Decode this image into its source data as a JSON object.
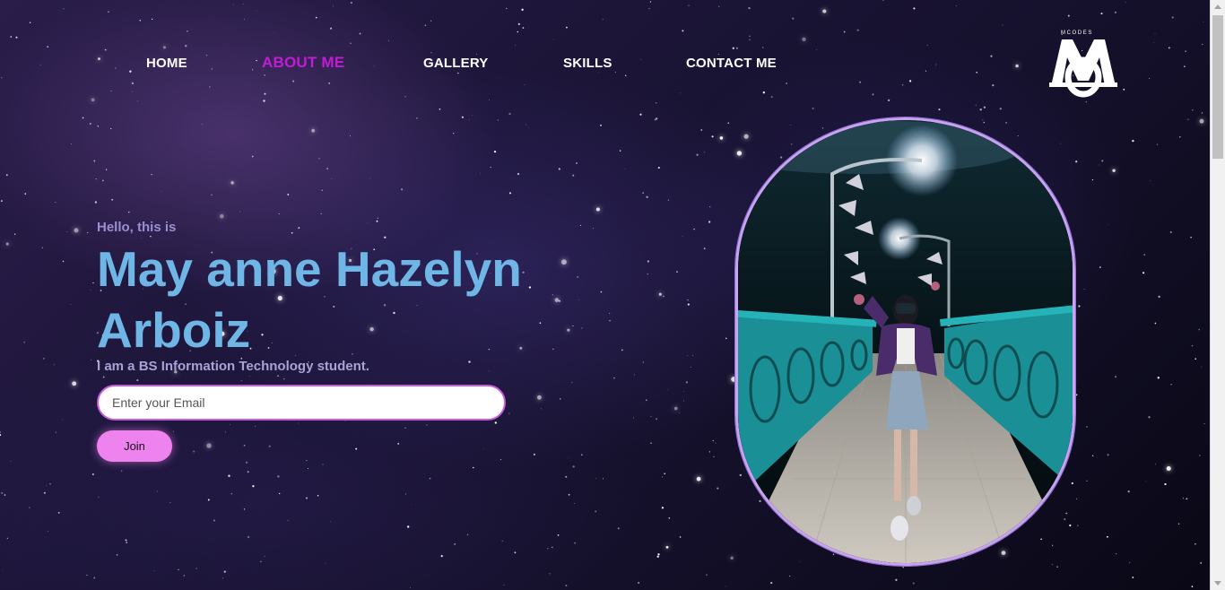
{
  "nav": {
    "items": [
      {
        "label": "HOME"
      },
      {
        "label": "ABOUT ME",
        "active": true
      },
      {
        "label": "GALLERY"
      },
      {
        "label": "SKILLS"
      },
      {
        "label": "CONTACT ME"
      }
    ]
  },
  "logo": {
    "small_text": "MCODES",
    "icon": "mo-monogram-logo"
  },
  "hero": {
    "greeting": "Hello, this is",
    "name": "May anne Hazelyn Arboiz",
    "subtitle": "I am a BS Information Technology student.",
    "email_placeholder": "Enter your Email",
    "join_label": "Join"
  },
  "colors": {
    "accent_active_nav": "#c21bd6",
    "name_blue": "#6fb6e6",
    "join_button": "#ee82ee",
    "input_border": "#c85bdc"
  }
}
